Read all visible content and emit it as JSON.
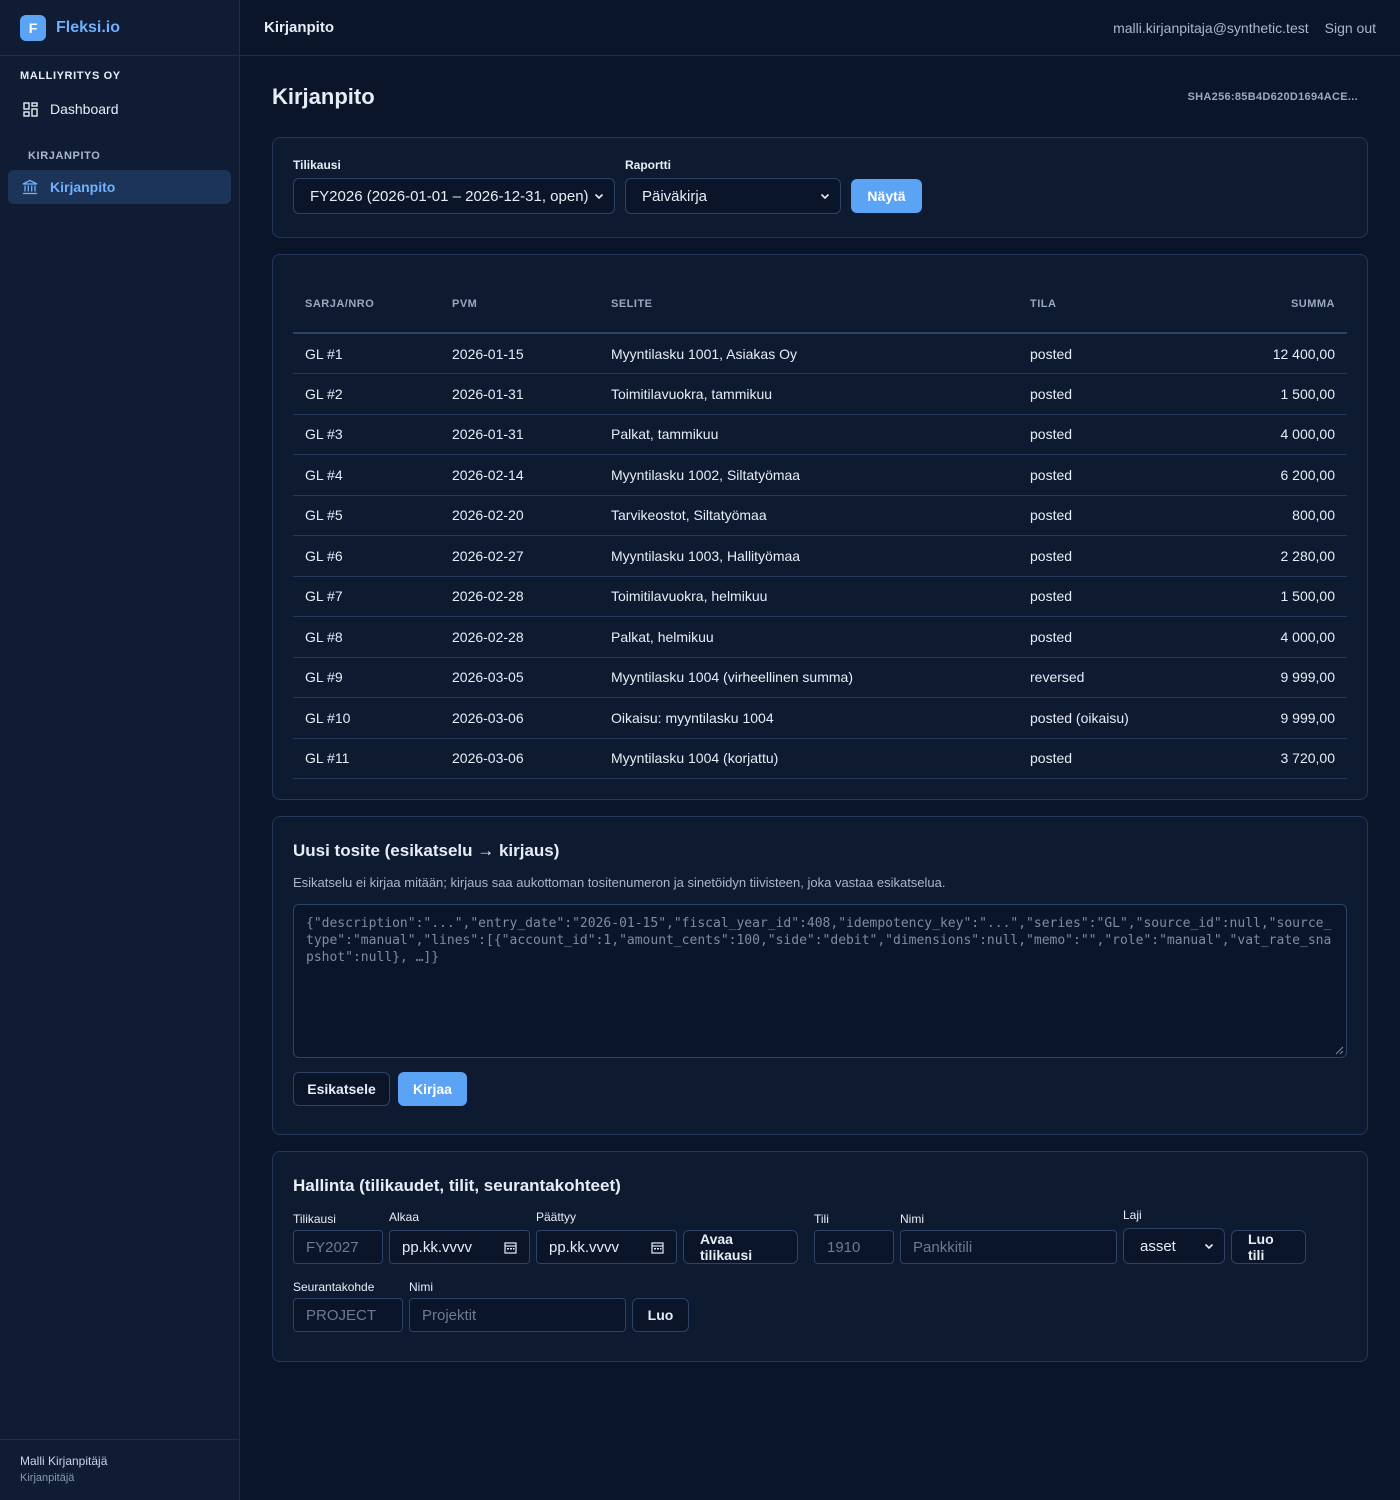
{
  "brand": {
    "logo_letter": "F",
    "name": "Fleksi.io"
  },
  "sidebar": {
    "org": "MALLIYRITYS OY",
    "items": [
      {
        "label": "Dashboard",
        "icon": "dashboard-icon"
      }
    ],
    "section": "KIRJANPITO",
    "active_item": {
      "label": "Kirjanpito",
      "icon": "bank-icon"
    },
    "user": {
      "name": "Malli Kirjanpitäjä",
      "role": "Kirjanpitäjä"
    }
  },
  "topbar": {
    "title": "Kirjanpito",
    "email": "malli.kirjanpitaja@synthetic.test",
    "signout": "Sign out"
  },
  "page": {
    "title": "Kirjanpito",
    "hash": "SHA256:85B4D620D1694ACE..."
  },
  "filters": {
    "fiscal_label": "Tilikausi",
    "fiscal_value": "FY2026 (2026-01-01 – 2026-12-31, open)",
    "report_label": "Raportti",
    "report_value": "Päiväkirja",
    "show_button": "Näytä"
  },
  "journal": {
    "headers": {
      "series": "SARJA/NRO",
      "date": "PVM",
      "desc": "SELITE",
      "status": "TILA",
      "amount": "SUMMA"
    },
    "rows": [
      {
        "series": "GL #1",
        "date": "2026-01-15",
        "desc": "Myyntilasku 1001, Asiakas Oy",
        "status": "posted",
        "amount": "12 400,00"
      },
      {
        "series": "GL #2",
        "date": "2026-01-31",
        "desc": "Toimitilavuokra, tammikuu",
        "status": "posted",
        "amount": "1 500,00"
      },
      {
        "series": "GL #3",
        "date": "2026-01-31",
        "desc": "Palkat, tammikuu",
        "status": "posted",
        "amount": "4 000,00"
      },
      {
        "series": "GL #4",
        "date": "2026-02-14",
        "desc": "Myyntilasku 1002, Siltatyömaa",
        "status": "posted",
        "amount": "6 200,00"
      },
      {
        "series": "GL #5",
        "date": "2026-02-20",
        "desc": "Tarvikeostot, Siltatyömaa",
        "status": "posted",
        "amount": "800,00"
      },
      {
        "series": "GL #6",
        "date": "2026-02-27",
        "desc": "Myyntilasku 1003, Hallityömaa",
        "status": "posted",
        "amount": "2 280,00"
      },
      {
        "series": "GL #7",
        "date": "2026-02-28",
        "desc": "Toimitilavuokra, helmikuu",
        "status": "posted",
        "amount": "1 500,00"
      },
      {
        "series": "GL #8",
        "date": "2026-02-28",
        "desc": "Palkat, helmikuu",
        "status": "posted",
        "amount": "4 000,00"
      },
      {
        "series": "GL #9",
        "date": "2026-03-05",
        "desc": "Myyntilasku 1004 (virheellinen summa)",
        "status": "reversed",
        "amount": "9 999,00"
      },
      {
        "series": "GL #10",
        "date": "2026-03-06",
        "desc": "Oikaisu: myyntilasku 1004",
        "status": "posted (oikaisu)",
        "amount": "9 999,00"
      },
      {
        "series": "GL #11",
        "date": "2026-03-06",
        "desc": "Myyntilasku 1004 (korjattu)",
        "status": "posted",
        "amount": "3 720,00"
      }
    ]
  },
  "new_entry": {
    "title": "Uusi tosite (esikatselu → kirjaus)",
    "description": "Esikatselu ei kirjaa mitään; kirjaus saa aukottoman tositenumeron ja sinetöidyn tiivisteen, joka vastaa esikatselua.",
    "placeholder": "{\"description\":\"...\",\"entry_date\":\"2026-01-15\",\"fiscal_year_id\":408,\"idempotency_key\":\"...\",\"series\":\"GL\",\"source_id\":null,\"source_type\":\"manual\",\"lines\":[{\"account_id\":1,\"amount_cents\":100,\"side\":\"debit\",\"dimensions\":null,\"memo\":\"\",\"role\":\"manual\",\"vat_rate_snapshot\":null}, …]}",
    "preview_button": "Esikatsele",
    "post_button": "Kirjaa"
  },
  "admin": {
    "title": "Hallinta (tilikaudet, tilit, seurantakohteet)",
    "fiscal": {
      "label": "Tilikausi",
      "placeholder": "FY2027",
      "start_label": "Alkaa",
      "start_value": "pp.kk.vvvv",
      "end_label": "Päättyy",
      "end_value": "pp.kk.vvvv",
      "button": "Avaa tilikausi"
    },
    "account": {
      "label": "Tili",
      "placeholder": "1910",
      "name_label": "Nimi",
      "name_placeholder": "Pankkitili",
      "type_label": "Laji",
      "type_value": "asset",
      "button": "Luo tili"
    },
    "dimension": {
      "label": "Seurantakohde",
      "placeholder": "PROJECT",
      "name_label": "Nimi",
      "name_placeholder": "Projektit",
      "button": "Luo"
    }
  }
}
